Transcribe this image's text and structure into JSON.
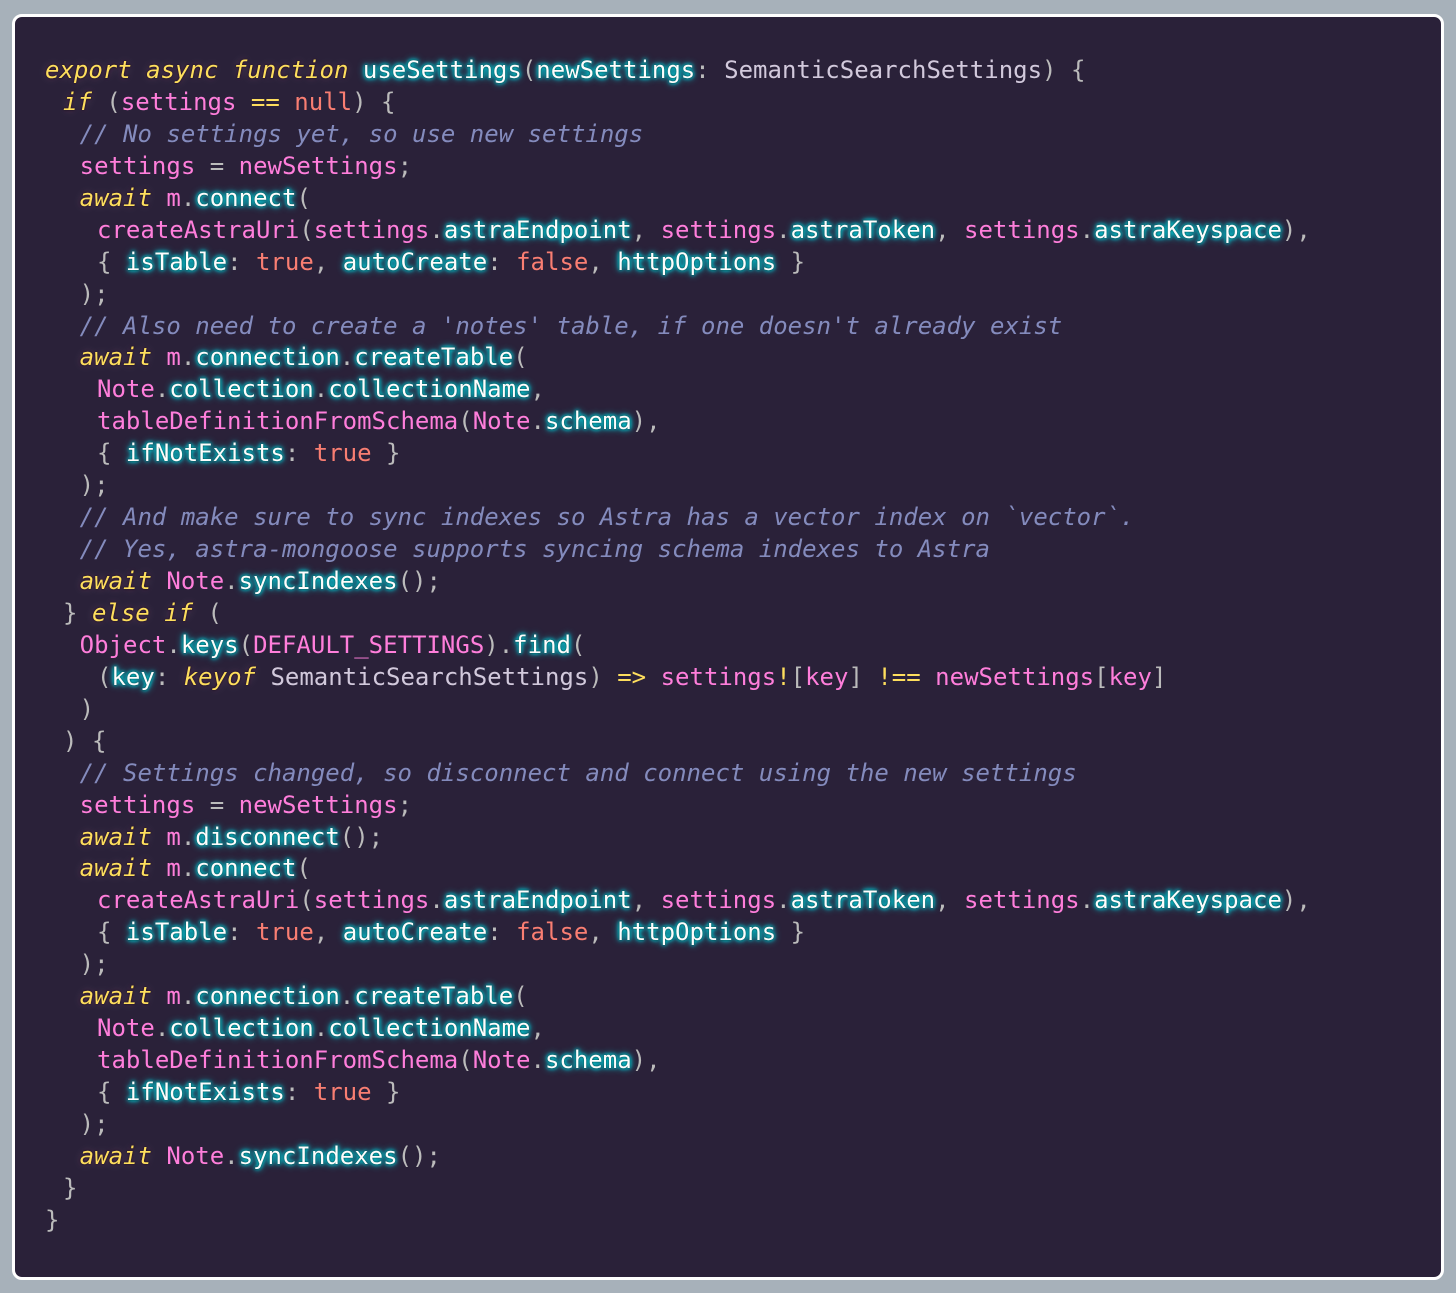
{
  "editor": {
    "background": "#2a2139",
    "border": "#ffffff",
    "theme_colors": {
      "keyword": "#fede5d",
      "variable": "#ff7edb",
      "identifier_glow": "#03edf9",
      "literal": "#f97e72",
      "comment": "#848bbd",
      "type": "#d2c9dc"
    },
    "lines": [
      {
        "indent": 0,
        "tokens": [
          [
            "kw",
            "export async function"
          ],
          [
            "p",
            " "
          ],
          [
            "id",
            "useSettings"
          ],
          [
            "p",
            "("
          ],
          [
            "id",
            "newSettings"
          ],
          [
            "p",
            ": "
          ],
          [
            "type",
            "SemanticSearchSettings"
          ],
          [
            "p",
            ") {"
          ]
        ]
      },
      {
        "indent": 1,
        "tokens": [
          [
            "kw",
            "if"
          ],
          [
            "p",
            " ("
          ],
          [
            "var",
            "settings"
          ],
          [
            "p",
            " "
          ],
          [
            "op",
            "=="
          ],
          [
            "p",
            " "
          ],
          [
            "lit",
            "null"
          ],
          [
            "p",
            ") {"
          ]
        ]
      },
      {
        "indent": 2,
        "tokens": [
          [
            "cmt",
            "// No settings yet, so use new settings"
          ]
        ]
      },
      {
        "indent": 2,
        "tokens": [
          [
            "var",
            "settings"
          ],
          [
            "p",
            " = "
          ],
          [
            "var",
            "newSettings"
          ],
          [
            "p",
            ";"
          ]
        ]
      },
      {
        "indent": 2,
        "tokens": [
          [
            "kw",
            "await"
          ],
          [
            "p",
            " "
          ],
          [
            "var",
            "m"
          ],
          [
            "p",
            "."
          ],
          [
            "id",
            "connect"
          ],
          [
            "p",
            "("
          ]
        ]
      },
      {
        "indent": 3,
        "tokens": [
          [
            "var",
            "createAstraUri"
          ],
          [
            "p",
            "("
          ],
          [
            "var",
            "settings"
          ],
          [
            "p",
            "."
          ],
          [
            "id",
            "astraEndpoint"
          ],
          [
            "p",
            ", "
          ],
          [
            "var",
            "settings"
          ],
          [
            "p",
            "."
          ],
          [
            "id",
            "astraToken"
          ],
          [
            "p",
            ", "
          ],
          [
            "var",
            "settings"
          ],
          [
            "p",
            "."
          ],
          [
            "id",
            "astraKeyspace"
          ],
          [
            "p",
            "),"
          ]
        ]
      },
      {
        "indent": 3,
        "tokens": [
          [
            "p",
            "{ "
          ],
          [
            "id",
            "isTable"
          ],
          [
            "p",
            ": "
          ],
          [
            "lit",
            "true"
          ],
          [
            "p",
            ", "
          ],
          [
            "id",
            "autoCreate"
          ],
          [
            "p",
            ": "
          ],
          [
            "lit",
            "false"
          ],
          [
            "p",
            ", "
          ],
          [
            "id",
            "httpOptions"
          ],
          [
            "p",
            " }"
          ]
        ]
      },
      {
        "indent": 2,
        "tokens": [
          [
            "p",
            ");"
          ]
        ]
      },
      {
        "indent": 2,
        "tokens": [
          [
            "cmt",
            "// Also need to create a 'notes' table, if one doesn't already exist"
          ]
        ]
      },
      {
        "indent": 2,
        "tokens": [
          [
            "kw",
            "await"
          ],
          [
            "p",
            " "
          ],
          [
            "var",
            "m"
          ],
          [
            "p",
            "."
          ],
          [
            "id",
            "connection"
          ],
          [
            "p",
            "."
          ],
          [
            "id",
            "createTable"
          ],
          [
            "p",
            "("
          ]
        ]
      },
      {
        "indent": 3,
        "tokens": [
          [
            "var",
            "Note"
          ],
          [
            "p",
            "."
          ],
          [
            "id",
            "collection"
          ],
          [
            "p",
            "."
          ],
          [
            "id",
            "collectionName"
          ],
          [
            "p",
            ","
          ]
        ]
      },
      {
        "indent": 3,
        "tokens": [
          [
            "var",
            "tableDefinitionFromSchema"
          ],
          [
            "p",
            "("
          ],
          [
            "var",
            "Note"
          ],
          [
            "p",
            "."
          ],
          [
            "id",
            "schema"
          ],
          [
            "p",
            "),"
          ]
        ]
      },
      {
        "indent": 3,
        "tokens": [
          [
            "p",
            "{ "
          ],
          [
            "id",
            "ifNotExists"
          ],
          [
            "p",
            ": "
          ],
          [
            "lit",
            "true"
          ],
          [
            "p",
            " }"
          ]
        ]
      },
      {
        "indent": 2,
        "tokens": [
          [
            "p",
            ");"
          ]
        ]
      },
      {
        "indent": 2,
        "tokens": [
          [
            "cmt",
            "// And make sure to sync indexes so Astra has a vector index on `vector`."
          ]
        ]
      },
      {
        "indent": 2,
        "tokens": [
          [
            "cmt",
            "// Yes, astra-mongoose supports syncing schema indexes to Astra"
          ]
        ]
      },
      {
        "indent": 2,
        "tokens": [
          [
            "kw",
            "await"
          ],
          [
            "p",
            " "
          ],
          [
            "var",
            "Note"
          ],
          [
            "p",
            "."
          ],
          [
            "id",
            "syncIndexes"
          ],
          [
            "p",
            "();"
          ]
        ]
      },
      {
        "indent": 1,
        "tokens": [
          [
            "p",
            "} "
          ],
          [
            "kw",
            "else if"
          ],
          [
            "p",
            " ("
          ]
        ]
      },
      {
        "indent": 2,
        "tokens": [
          [
            "var",
            "Object"
          ],
          [
            "p",
            "."
          ],
          [
            "id",
            "keys"
          ],
          [
            "p",
            "("
          ],
          [
            "var",
            "DEFAULT_SETTINGS"
          ],
          [
            "p",
            ")."
          ],
          [
            "id",
            "find"
          ],
          [
            "p",
            "("
          ]
        ]
      },
      {
        "indent": 3,
        "tokens": [
          [
            "p",
            "("
          ],
          [
            "id",
            "key"
          ],
          [
            "p",
            ": "
          ],
          [
            "kw",
            "keyof"
          ],
          [
            "p",
            " "
          ],
          [
            "type",
            "SemanticSearchSettings"
          ],
          [
            "p",
            ") "
          ],
          [
            "op",
            "=>"
          ],
          [
            "p",
            " "
          ],
          [
            "var",
            "settings"
          ],
          [
            "op",
            "!"
          ],
          [
            "p",
            "["
          ],
          [
            "var",
            "key"
          ],
          [
            "p",
            "] "
          ],
          [
            "op",
            "!=="
          ],
          [
            "p",
            " "
          ],
          [
            "var",
            "newSettings"
          ],
          [
            "p",
            "["
          ],
          [
            "var",
            "key"
          ],
          [
            "p",
            "]"
          ]
        ]
      },
      {
        "indent": 2,
        "tokens": [
          [
            "p",
            ")"
          ]
        ]
      },
      {
        "indent": 1,
        "tokens": [
          [
            "p",
            ") {"
          ]
        ]
      },
      {
        "indent": 2,
        "tokens": [
          [
            "cmt",
            "// Settings changed, so disconnect and connect using the new settings"
          ]
        ]
      },
      {
        "indent": 2,
        "tokens": [
          [
            "var",
            "settings"
          ],
          [
            "p",
            " = "
          ],
          [
            "var",
            "newSettings"
          ],
          [
            "p",
            ";"
          ]
        ]
      },
      {
        "indent": 2,
        "tokens": [
          [
            "kw",
            "await"
          ],
          [
            "p",
            " "
          ],
          [
            "var",
            "m"
          ],
          [
            "p",
            "."
          ],
          [
            "id",
            "disconnect"
          ],
          [
            "p",
            "();"
          ]
        ]
      },
      {
        "indent": 2,
        "tokens": [
          [
            "kw",
            "await"
          ],
          [
            "p",
            " "
          ],
          [
            "var",
            "m"
          ],
          [
            "p",
            "."
          ],
          [
            "id",
            "connect"
          ],
          [
            "p",
            "("
          ]
        ]
      },
      {
        "indent": 3,
        "tokens": [
          [
            "var",
            "createAstraUri"
          ],
          [
            "p",
            "("
          ],
          [
            "var",
            "settings"
          ],
          [
            "p",
            "."
          ],
          [
            "id",
            "astraEndpoint"
          ],
          [
            "p",
            ", "
          ],
          [
            "var",
            "settings"
          ],
          [
            "p",
            "."
          ],
          [
            "id",
            "astraToken"
          ],
          [
            "p",
            ", "
          ],
          [
            "var",
            "settings"
          ],
          [
            "p",
            "."
          ],
          [
            "id",
            "astraKeyspace"
          ],
          [
            "p",
            "),"
          ]
        ]
      },
      {
        "indent": 3,
        "tokens": [
          [
            "p",
            "{ "
          ],
          [
            "id",
            "isTable"
          ],
          [
            "p",
            ": "
          ],
          [
            "lit",
            "true"
          ],
          [
            "p",
            ", "
          ],
          [
            "id",
            "autoCreate"
          ],
          [
            "p",
            ": "
          ],
          [
            "lit",
            "false"
          ],
          [
            "p",
            ", "
          ],
          [
            "id",
            "httpOptions"
          ],
          [
            "p",
            " }"
          ]
        ]
      },
      {
        "indent": 2,
        "tokens": [
          [
            "p",
            ");"
          ]
        ]
      },
      {
        "indent": 2,
        "tokens": [
          [
            "kw",
            "await"
          ],
          [
            "p",
            " "
          ],
          [
            "var",
            "m"
          ],
          [
            "p",
            "."
          ],
          [
            "id",
            "connection"
          ],
          [
            "p",
            "."
          ],
          [
            "id",
            "createTable"
          ],
          [
            "p",
            "("
          ]
        ]
      },
      {
        "indent": 3,
        "tokens": [
          [
            "var",
            "Note"
          ],
          [
            "p",
            "."
          ],
          [
            "id",
            "collection"
          ],
          [
            "p",
            "."
          ],
          [
            "id",
            "collectionName"
          ],
          [
            "p",
            ","
          ]
        ]
      },
      {
        "indent": 3,
        "tokens": [
          [
            "var",
            "tableDefinitionFromSchema"
          ],
          [
            "p",
            "("
          ],
          [
            "var",
            "Note"
          ],
          [
            "p",
            "."
          ],
          [
            "id",
            "schema"
          ],
          [
            "p",
            "),"
          ]
        ]
      },
      {
        "indent": 3,
        "tokens": [
          [
            "p",
            "{ "
          ],
          [
            "id",
            "ifNotExists"
          ],
          [
            "p",
            ": "
          ],
          [
            "lit",
            "true"
          ],
          [
            "p",
            " }"
          ]
        ]
      },
      {
        "indent": 2,
        "tokens": [
          [
            "p",
            ");"
          ]
        ]
      },
      {
        "indent": 2,
        "tokens": [
          [
            "kw",
            "await"
          ],
          [
            "p",
            " "
          ],
          [
            "var",
            "Note"
          ],
          [
            "p",
            "."
          ],
          [
            "id",
            "syncIndexes"
          ],
          [
            "p",
            "();"
          ]
        ]
      },
      {
        "indent": 1,
        "tokens": [
          [
            "p",
            "}"
          ]
        ]
      },
      {
        "indent": 0,
        "tokens": [
          [
            "p",
            "}"
          ]
        ]
      }
    ]
  }
}
